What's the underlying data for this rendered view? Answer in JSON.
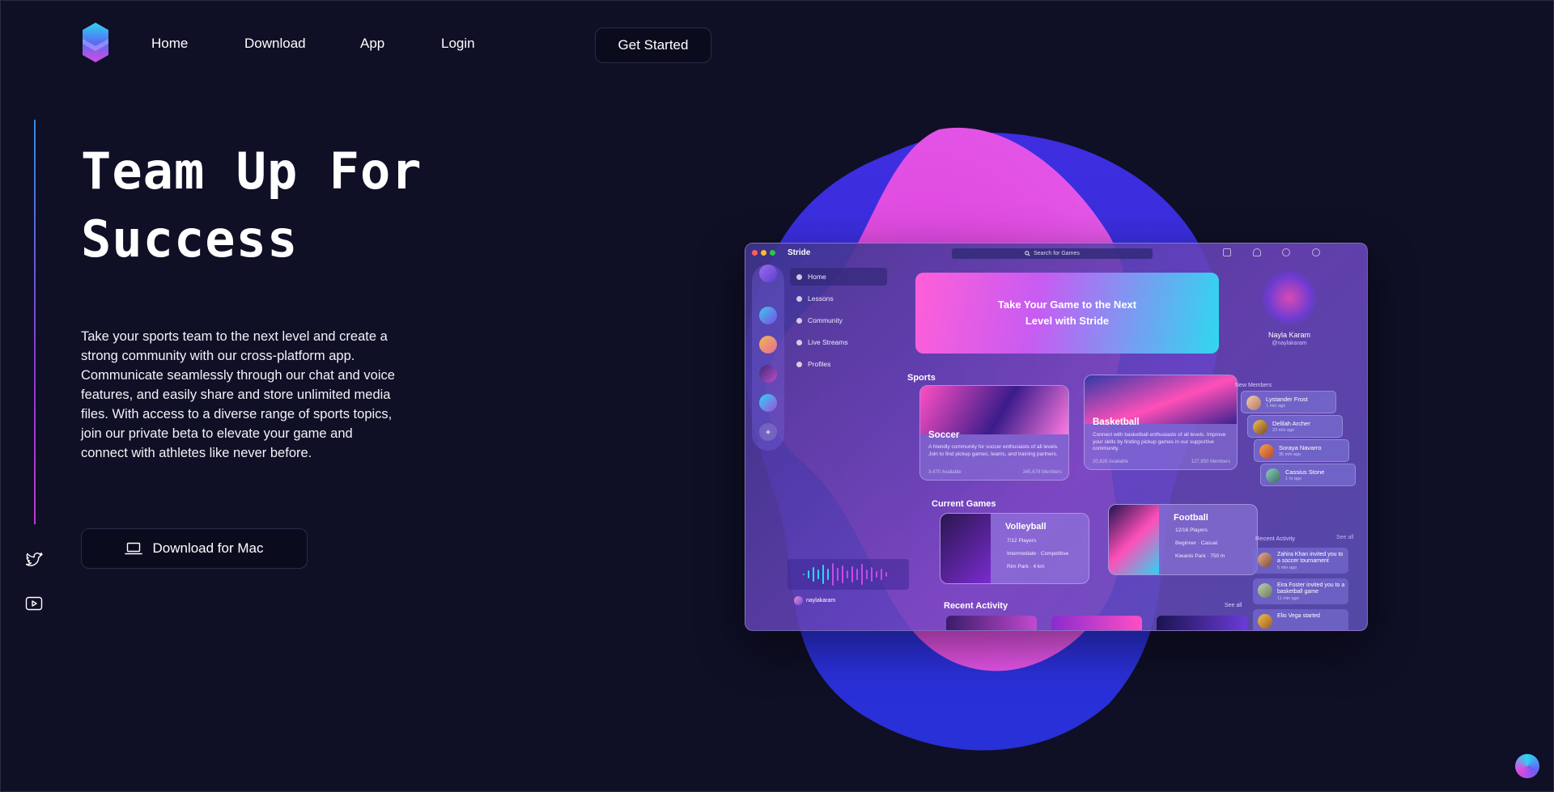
{
  "nav": {
    "items": [
      {
        "label": "Home"
      },
      {
        "label": "Download"
      },
      {
        "label": "App"
      },
      {
        "label": "Login"
      }
    ],
    "cta_label": "Get Started"
  },
  "hero": {
    "title_line1": "Team Up For",
    "title_line2": "Success",
    "description": "Take your sports team to the next level and create a strong community with our cross-platform app. Communicate seamlessly through our chat and voice features, and easily share and store unlimited media files. With access to a diverse range of sports topics, join our private beta to elevate your game and connect with athletes like never before.",
    "download_label": "Download for Mac"
  },
  "social": {
    "icons": [
      "twitter-icon",
      "youtube-icon"
    ]
  },
  "colors": {
    "background": "#0f0f26",
    "blob_pink": "#e04be0",
    "blob_blue": "#2a2fe0",
    "accent_cyan": "#2fd8f0"
  },
  "app_preview": {
    "app_name": "Stride",
    "search_placeholder": "Search for Games",
    "sidebar": [
      "Home",
      "Lessons",
      "Community",
      "Live Streams",
      "Profiles"
    ],
    "username": "naylakaram",
    "banner": "Take Your Game to the Next Level with Stride",
    "sports_title": "Sports",
    "sports": [
      {
        "name": "Soccer",
        "desc": "A friendly community for soccer enthusiasts of all levels. Join to find pickup games, teams, and training partners.",
        "available": "3,470 Available",
        "members": "345,678 Members"
      },
      {
        "name": "Basketball",
        "desc": "Connect with basketball enthusiasts of all levels. Improve your skills by finding pickup games in our supportive community.",
        "available": "20,828 Available",
        "members": "127,950 Members"
      }
    ],
    "current_games_title": "Current Games",
    "games": [
      {
        "name": "Volleyball",
        "players": "7/12 Players",
        "level": "Intermediate · Competitive",
        "place": "Rim Park · 4 km"
      },
      {
        "name": "Football",
        "players": "12/16 Players",
        "level": "Beginner · Casual",
        "place": "Kiwanis Park · 750 m"
      }
    ],
    "recent_activity_title": "Recent Activity",
    "see_all": "See all",
    "profile": {
      "name": "Nayla Karam",
      "handle": "@naylakaram"
    },
    "new_members_title": "New Members",
    "members": [
      {
        "name": "Lystander Frost",
        "time": "1 min ago"
      },
      {
        "name": "Delilah Archer",
        "time": "23 min ago"
      },
      {
        "name": "Soraya Navarro",
        "time": "35 min ago"
      },
      {
        "name": "Cassius Stone",
        "time": "1 hr ago"
      }
    ],
    "side_recent_title": "Recent Activity",
    "activity": [
      {
        "text": "Zahira Khan invited you to a soccer tournament",
        "time": "5 min ago"
      },
      {
        "text": "Eira Foster invited you to a basketball game",
        "time": "11 min ago"
      },
      {
        "text": "Elio Vega started",
        "time": ""
      }
    ]
  }
}
